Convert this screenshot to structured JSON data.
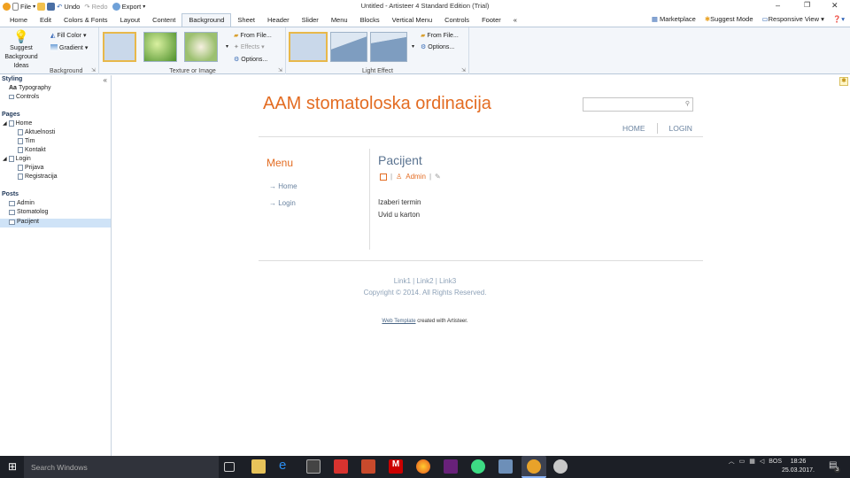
{
  "window": {
    "title": "Untitled - Artisteer 4 Standard Edition (Trial)"
  },
  "quick_access": {
    "file": "File",
    "undo": "Undo",
    "redo": "Redo",
    "export": "Export"
  },
  "menu_tabs": [
    "Home",
    "Edit",
    "Colors & Fonts",
    "Layout",
    "Content",
    "Background",
    "Sheet",
    "Header",
    "Slider",
    "Menu",
    "Blocks",
    "Vertical Menu",
    "Controls",
    "Footer"
  ],
  "active_tab": "Background",
  "tabs_overflow": "«",
  "right_menu": {
    "marketplace": "Marketplace",
    "suggest_mode": "Suggest Mode",
    "responsive_view": "Responsive View"
  },
  "ribbon": {
    "suggest": {
      "line1": "Suggest",
      "line2": "Background",
      "line3": "Ideas"
    },
    "fill_color": "Fill Color",
    "gradient": "Gradient",
    "group_background": "Background",
    "group_texture": "Texture or Image",
    "from_file": "From File...",
    "effects": "Effects",
    "options": "Options...",
    "group_light": "Light Effect",
    "from_file_2": "From File...",
    "options_2": "Options..."
  },
  "left_panel": {
    "styling": "Styling",
    "typography": "Typography",
    "typography_prefix": "Aa",
    "controls": "Controls",
    "pages": "Pages",
    "home": "Home",
    "aktuelnosti": "Aktuelnosti",
    "tim": "Tim",
    "kontakt": "Kontakt",
    "login": "Login",
    "prijava": "Prijava",
    "registracija": "Registracija",
    "posts": "Posts",
    "admin": "Admin",
    "stomatolog": "Stomatolog",
    "pacijent": "Pacijent",
    "collapse": "«"
  },
  "site": {
    "title": "AAM stomatoloska ordinacija",
    "nav": [
      "HOME",
      "LOGIN"
    ],
    "menu_header": "Menu",
    "menu_items": [
      "Home",
      "Login"
    ],
    "post_title": "Pacijent",
    "post_author": "Admin",
    "post_lines": [
      "Izaberi termin",
      "Uvid u karton"
    ],
    "footer_links": "Link1 | Link2 | Link3",
    "copyright": "Copyright © 2014. All Rights Reserved.",
    "credit_link": "Web Template",
    "credit_text": " created with Artisteer."
  },
  "taskbar": {
    "search_placeholder": "Search Windows",
    "lang": "BOS",
    "time": "18:26",
    "date": "25.03.2017.",
    "notifications": "3"
  },
  "colors": {
    "accent": "#e36c22",
    "link": "#6a83a0",
    "ribbon_bg": "#f3f6fa"
  }
}
